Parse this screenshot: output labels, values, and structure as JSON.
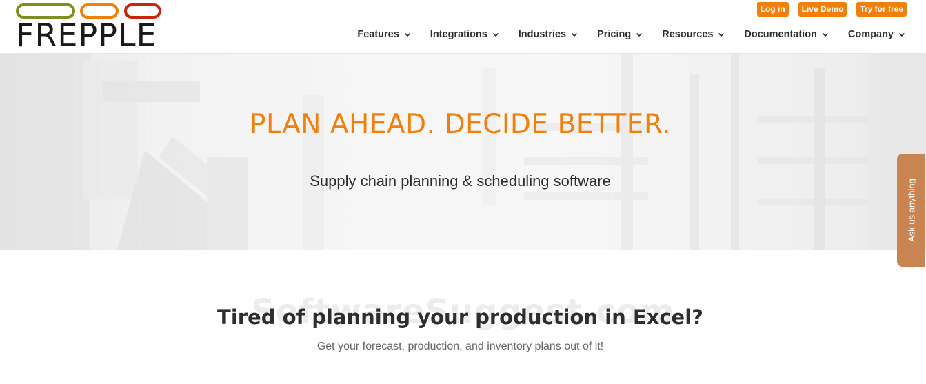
{
  "brand": {
    "name": "FREPPLE",
    "pill_colors": [
      "#7f8f1e",
      "#f07f0b",
      "#c8250d"
    ]
  },
  "top_actions": [
    {
      "label": "Log in"
    },
    {
      "label": "Live Demo"
    },
    {
      "label": "Try for free"
    }
  ],
  "nav": [
    {
      "label": "Features"
    },
    {
      "label": "Integrations"
    },
    {
      "label": "Industries"
    },
    {
      "label": "Pricing"
    },
    {
      "label": "Resources"
    },
    {
      "label": "Documentation"
    },
    {
      "label": "Company"
    }
  ],
  "hero": {
    "title": "PLAN AHEAD. DECIDE BETTER.",
    "subtitle": "Supply chain planning & scheduling software"
  },
  "ask_tab": {
    "label": "Ask us anything"
  },
  "section": {
    "watermark": "SoftwareSuggest.com",
    "title": "Tired of planning your production in Excel?",
    "subtitle": "Get your forecast, production, and inventory plans out of it!"
  },
  "colors": {
    "accent": "#f07f0b",
    "ask_tab": "#c88552"
  }
}
